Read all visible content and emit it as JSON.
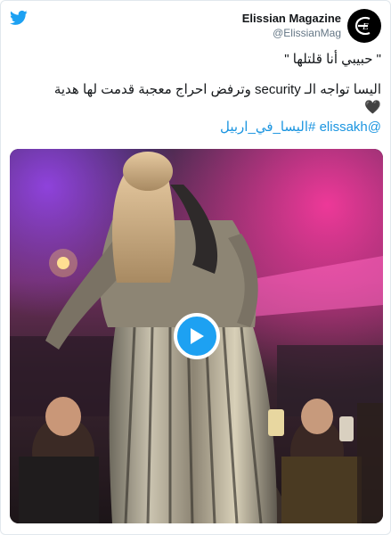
{
  "header": {
    "display_name": "Elissian Magazine",
    "handle": "@ElissianMag",
    "avatar_letter": "E"
  },
  "tweet": {
    "line1": "\" حبيبي أنا قلتلها \"",
    "line2": "اليسا تواجه الـ security وترفض احراج معجبة قدمت لها هدية",
    "heart": "🖤",
    "hashtag": "#اليسا_في_اربيل",
    "mention": "@elissakh"
  },
  "icons": {
    "brand": "twitter-bird-icon",
    "play": "play-icon"
  },
  "colors": {
    "twitter_blue": "#1da1f2",
    "link": "#1b95e0",
    "text": "#14171a",
    "muted": "#657786",
    "border": "#e1e8ed"
  }
}
